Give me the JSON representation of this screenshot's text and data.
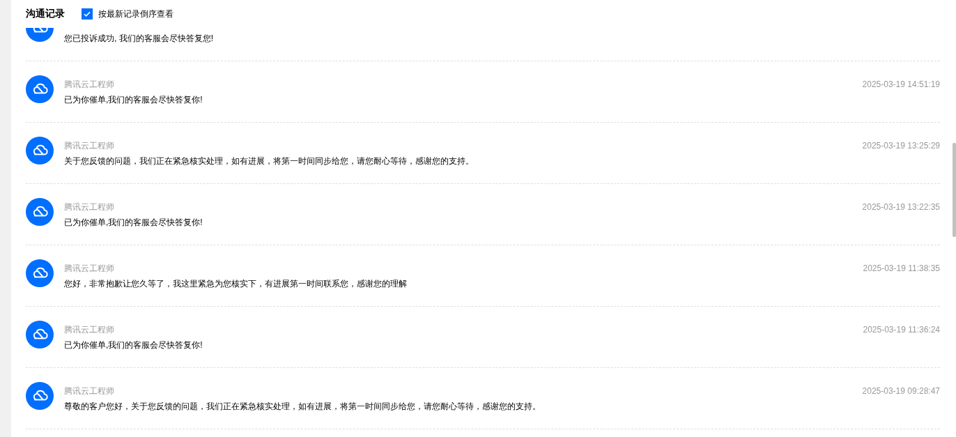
{
  "header": {
    "title": "沟通记录",
    "sort_option": {
      "label": "按最新记录倒序查看",
      "checked": true
    }
  },
  "records": [
    {
      "message": "您已投诉成功, 我们的客服会尽快答复您!"
    },
    {
      "sender": "腾讯云工程师",
      "time": "2025-03-19 14:51:19",
      "message": "已为你催单,我们的客服会尽快答复你!"
    },
    {
      "sender": "腾讯云工程师",
      "time": "2025-03-19 13:25:29",
      "message": "关于您反馈的问题，我们正在紧急核实处理，如有进展，将第一时间同步给您，请您耐心等待，感谢您的支持。"
    },
    {
      "sender": "腾讯云工程师",
      "time": "2025-03-19 13:22:35",
      "message": "已为你催单,我们的客服会尽快答复你!"
    },
    {
      "sender": "腾讯云工程师",
      "time": "2025-03-19 11:38:35",
      "message": "您好，非常抱歉让您久等了，我这里紧急为您核实下，有进展第一时间联系您，感谢您的理解"
    },
    {
      "sender": "腾讯云工程师",
      "time": "2025-03-19 11:36:24",
      "message": "已为你催单,我们的客服会尽快答复你!"
    },
    {
      "sender": "腾讯云工程师",
      "time": "2025-03-19 09:28:47",
      "message": "尊敬的客户您好，关于您反馈的问题，我们正在紧急核实处理，如有进展，将第一时间同步给您，请您耐心等待，感谢您的支持。"
    }
  ]
}
